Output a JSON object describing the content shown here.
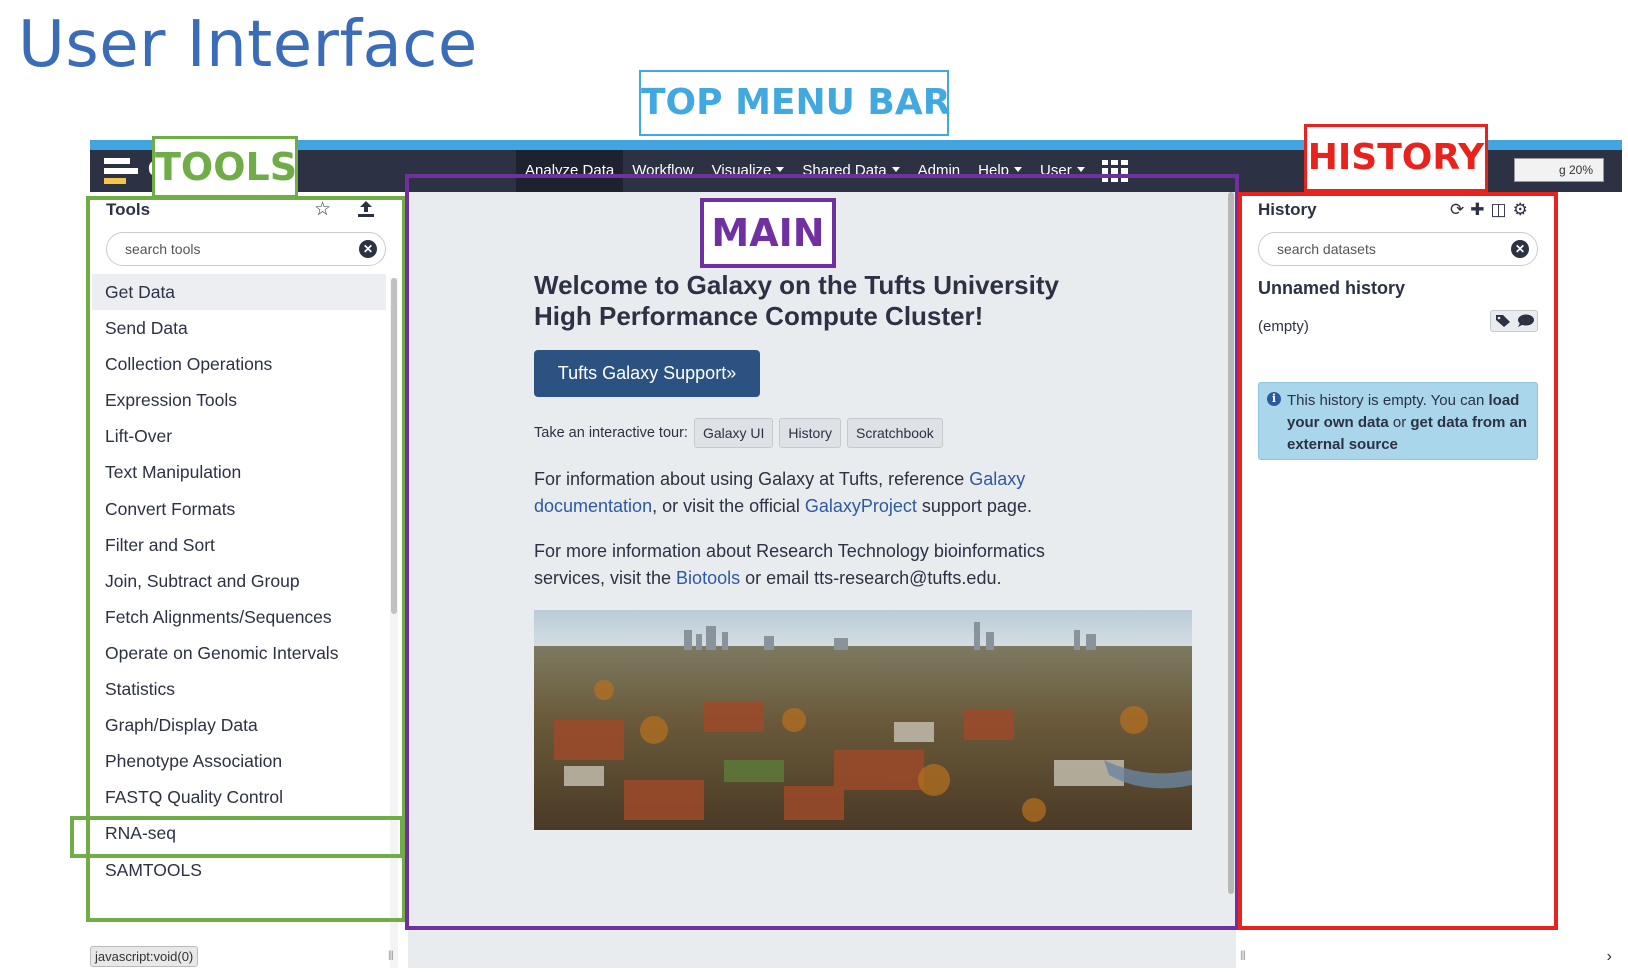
{
  "slide": {
    "title": "User Interface"
  },
  "annotations": {
    "top_menu_bar": "TOP MENU BAR",
    "tools": "TOOLS",
    "main": "MAIN",
    "history": "HISTORY",
    "colors": {
      "top_menu_bar": "#41a9e0",
      "tools": "#70ad47",
      "main": "#7030a0",
      "history": "#e8231e"
    }
  },
  "topbar": {
    "brand_fragment": "G",
    "menu": [
      {
        "label": "Analyze Data",
        "active": true,
        "dropdown": false
      },
      {
        "label": "Workflow",
        "active": false,
        "dropdown": false
      },
      {
        "label": "Visualize",
        "active": false,
        "dropdown": true
      },
      {
        "label": "Shared Data",
        "active": false,
        "dropdown": true
      },
      {
        "label": "Admin",
        "active": false,
        "dropdown": false
      },
      {
        "label": "Help",
        "active": false,
        "dropdown": true
      },
      {
        "label": "User",
        "active": false,
        "dropdown": true
      }
    ],
    "apps_icon": "grid-icon",
    "quota": "g 20%"
  },
  "tool_panel": {
    "title": "Tools",
    "favorites_icon": "star-icon",
    "upload_icon": "upload-icon",
    "search_placeholder": "search tools",
    "items": [
      "Get Data",
      "Send Data",
      "Collection Operations",
      "Expression Tools",
      "Lift-Over",
      "Text Manipulation",
      "Convert Formats",
      "Filter and Sort",
      "Join, Subtract and Group",
      "Fetch Alignments/Sequences",
      "Operate on Genomic Intervals",
      "Statistics",
      "Graph/Display Data",
      "Phenotype Association",
      "FASTQ Quality Control",
      "RNA-seq",
      "SAMTOOLS"
    ],
    "status_url": "javascript:void(0)"
  },
  "center": {
    "welcome_title": "Welcome to Galaxy on the Tufts University High Performance Compute Cluster!",
    "support_button": "Tufts Galaxy Support»",
    "tour_label": "Take an interactive tour:",
    "tour_buttons": [
      "Galaxy UI",
      "History",
      "Scratchbook"
    ],
    "para1": {
      "t1": "For information about using Galaxy at Tufts, reference ",
      "link1": "Galaxy documentation",
      "t2": ", or visit the official ",
      "link2": "GalaxyProject",
      "t3": " support page."
    },
    "para2": {
      "t1": "For more information about Research Technology bioinformatics services, visit the ",
      "link1": "Biotools",
      "t2": " or email tts-research@tufts.edu."
    }
  },
  "history": {
    "title": "History",
    "icons": [
      "refresh-icon",
      "plus-icon",
      "columns-icon",
      "gear-icon"
    ],
    "search_placeholder": "search datasets",
    "name": "Unnamed history",
    "empty_label": "(empty)",
    "info": {
      "t1": "This history is empty. You can ",
      "link1": "load your own data",
      "t2": " or ",
      "link2": "get data from an external source"
    }
  }
}
